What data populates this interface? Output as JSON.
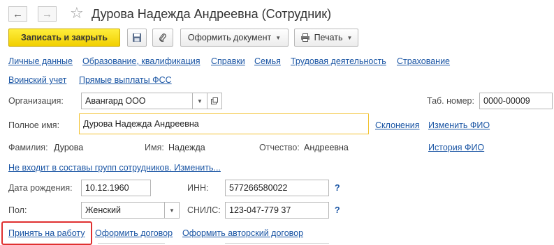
{
  "window": {
    "title": "Дурова Надежда Андреевна (Сотрудник)"
  },
  "nav": {
    "back_icon": "arrow-left-icon",
    "forward_icon": "arrow-right-icon",
    "favorite_icon": "star-icon"
  },
  "toolbar": {
    "save_close_label": "Записать и закрыть",
    "save_icon": "floppy-disk-icon",
    "attach_icon": "paperclip-icon",
    "make_document_label": "Оформить документ",
    "print_label": "Печать",
    "print_icon": "printer-icon",
    "primary_color": "#f5d800"
  },
  "sections": {
    "row1": [
      "Личные данные",
      "Образование, квалификация",
      "Справки",
      "Семья",
      "Трудовая деятельность",
      "Страхование"
    ],
    "row2": [
      "Воинский учет",
      "Прямые выплаты ФСС"
    ]
  },
  "form": {
    "organization_label": "Организация:",
    "organization_value": "Авангард ООО",
    "tab_number_label": "Таб. номер:",
    "tab_number_value": "0000-00009",
    "full_name_label": "Полное имя:",
    "full_name_value": "Дурова Надежда Андреевна",
    "declensions_link": "Склонения",
    "change_name_link": "Изменить ФИО",
    "surname_label": "Фамилия:",
    "surname_value": "Дурова",
    "name_label": "Имя:",
    "name_value": "Надежда",
    "patronymic_label": "Отчество:",
    "patronymic_value": "Андреевна",
    "name_history_link": "История ФИО",
    "groups_link": "Не входит в составы групп сотрудников. Изменить...",
    "birth_date_label": "Дата рождения:",
    "birth_date_value": "10.12.1960",
    "inn_label": "ИНН:",
    "inn_value": "577266580022",
    "help_mark": "?",
    "gender_label": "Пол:",
    "gender_value": "Женский",
    "snils_label": "СНИЛС:",
    "snils_value": "123-047-779 37"
  },
  "actions": {
    "hire_link": "Принять на работу",
    "contract_link": "Оформить договор",
    "author_contract_link": "Оформить авторский договор",
    "highlight_color": "#e03030"
  }
}
